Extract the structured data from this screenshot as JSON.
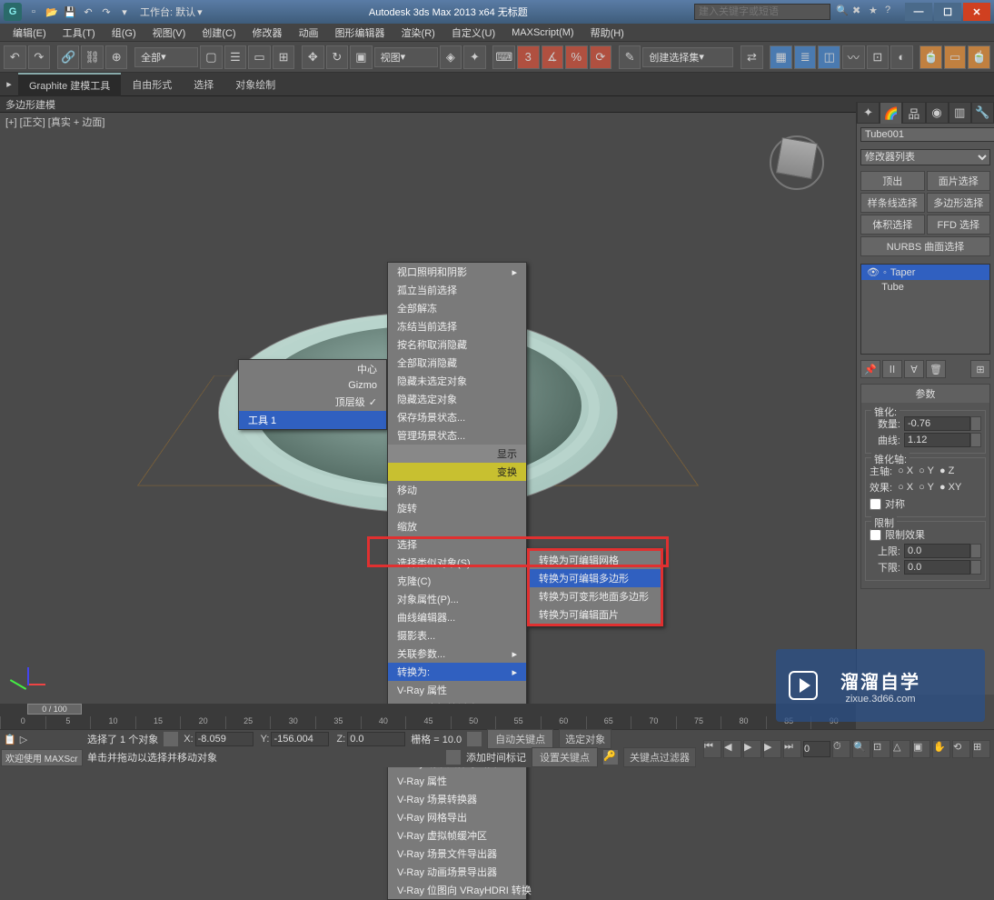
{
  "titlebar": {
    "workspace_label": "工作台: 默认",
    "app_title": "Autodesk 3ds Max  2013 x64   无标题",
    "search_placeholder": "建入关键字或短语"
  },
  "menus": [
    "编辑(E)",
    "工具(T)",
    "组(G)",
    "视图(V)",
    "创建(C)",
    "修改器",
    "动画",
    "图形编辑器",
    "渲染(R)",
    "自定义(U)",
    "MAXScript(M)",
    "帮助(H)"
  ],
  "toolbar": {
    "filter_dropdown": "全部",
    "view_dropdown": "视图",
    "named_sel": "创建选择集"
  },
  "ribbon": {
    "tabs": [
      "Graphite 建模工具",
      "自由形式",
      "选择",
      "对象绘制"
    ],
    "sub": "多边形建模"
  },
  "viewport": {
    "label": "[+] [正交] [真实 + 边面]"
  },
  "quad_left": {
    "items": [
      "中心",
      "Gizmo",
      "顶层级"
    ],
    "footer": "工具 1"
  },
  "quad_right": {
    "group1": [
      "视口照明和阴影",
      "孤立当前选择",
      "全部解冻",
      "冻结当前选择",
      "按名称取消隐藏",
      "全部取消隐藏",
      "隐藏未选定对象",
      "隐藏选定对象",
      "保存场景状态...",
      "管理场景状态..."
    ],
    "header1": "显示",
    "header2": "变换",
    "group2": [
      "移动",
      "旋转",
      "缩放",
      "选择",
      "选择类似对象(S)",
      "克隆(C)",
      "对象属性(P)...",
      "曲线编辑器...",
      "摄影表...",
      "关联参数...",
      "转换为:",
      "V-Ray 属性",
      "V-Ray 虚拟帧缓冲区",
      "V-Ray 场景转换器",
      "V-Ray 网格导出",
      "V-Ray 场景文件导出器",
      "V-Ray 属性",
      "V-Ray 场景转换器",
      "V-Ray 网格导出",
      "V-Ray 虚拟帧缓冲区",
      "V-Ray 场景文件导出器",
      "V-Ray 动画场景导出器",
      "V-Ray 位图向 VRayHDRI 转换"
    ]
  },
  "convert_submenu": [
    "转换为可编辑网格",
    "转换为可编辑多边形",
    "转换为可变形地面多边形",
    "转换为可编辑面片"
  ],
  "cmdpanel": {
    "object_name": "Tube001",
    "modifier_list": "修改器列表",
    "sel_buttons": [
      "顶出",
      "面片选择",
      "样条线选择",
      "多边形选择",
      "体积选择",
      "FFD 选择"
    ],
    "nurbs_btn": "NURBS 曲面选择",
    "stack": [
      "Taper",
      "Tube"
    ],
    "rollout_params": "参数",
    "taper_group": "锥化:",
    "amount_label": "数量:",
    "amount_value": "-0.76",
    "curve_label": "曲线:",
    "curve_value": "1.12",
    "axis_group": "锥化轴:",
    "primary_label": "主轴:",
    "effect_label": "效果:",
    "symmetry": "对称",
    "limit_group": "限制",
    "limit_effect": "限制效果",
    "upper_label": "上限:",
    "upper_value": "0.0",
    "lower_label": "下限:",
    "lower_value": "0.0"
  },
  "timeline": {
    "handle": "0 / 100",
    "ticks": [
      "0",
      "5",
      "10",
      "15",
      "20",
      "25",
      "30",
      "35",
      "40",
      "45",
      "50",
      "55",
      "60",
      "65",
      "70",
      "75",
      "80",
      "85",
      "90"
    ]
  },
  "status": {
    "script_tab": "欢迎使用  MAXScr",
    "sel_info": "选择了 1 个对象",
    "prompt": "单击并拖动以选择并移动对象",
    "x": "-8.059",
    "y": "-156.004",
    "z": "0.0",
    "grid": "栅格 = 10.0",
    "addtime": "添加时间标记",
    "autokey": "自动关键点",
    "setkey": "设置关键点",
    "selfilter": "选定对象",
    "keyfilter": "关键点过滤器"
  },
  "watermark": {
    "brand": "溜溜自学",
    "url": "zixue.3d66.com"
  }
}
